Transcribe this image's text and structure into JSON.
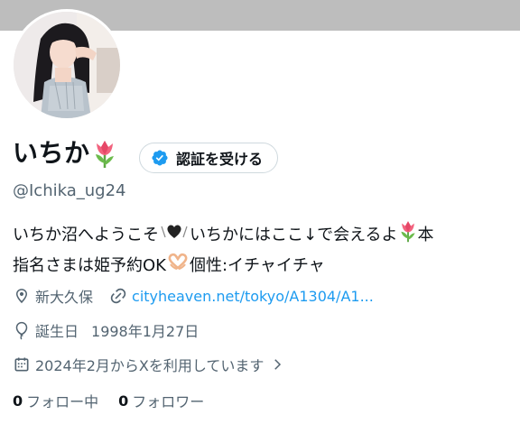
{
  "profile": {
    "display_name": "いちか",
    "name_emoji": "tulip-emoji",
    "handle": "@Ichika_ug24",
    "verify_button_label": "認証を受ける",
    "bio_line1_part1": "いちか沼へようこそ",
    "bio_line1_part2": "いちかにはここ↓で会えるよ",
    "bio_line1_part3": "本",
    "bio_line2_part1": "指名さまは姫予約OK",
    "bio_line2_part2": "個性:イチャイチャ",
    "location": "新大久保",
    "website": "cityheaven.net/tokyo/A1304/A1...",
    "birthday_label": "誕生日",
    "birthday": "1998年1月27日",
    "joined": "2024年2月からXを利用しています",
    "following_count": "0",
    "following_label": "フォロー中",
    "followers_count": "0",
    "followers_label": "フォロワー"
  },
  "colors": {
    "banner": "#bdbdbd",
    "secondary_text": "#536471",
    "link": "#1d9bf0",
    "verified_badge": "#1d9bf0"
  },
  "icons": {
    "location": "location-pin-icon",
    "link": "link-icon",
    "birthday": "balloon-icon",
    "joined": "calendar-icon",
    "chevron": "chevron-right-icon"
  }
}
